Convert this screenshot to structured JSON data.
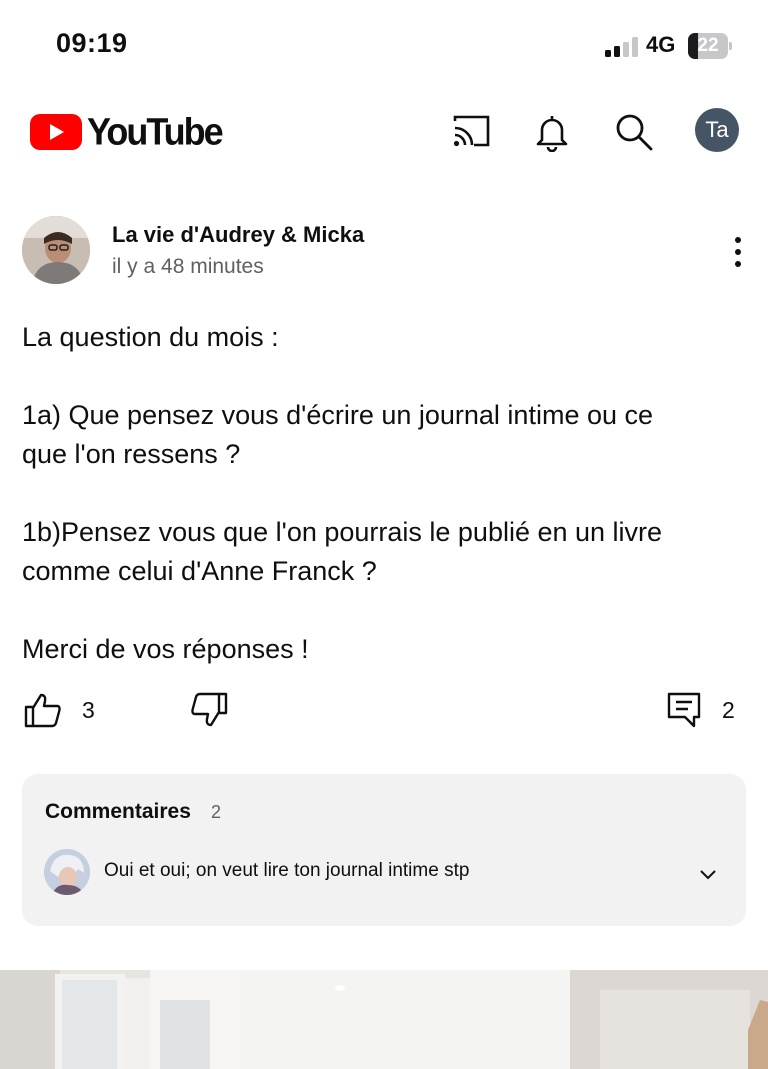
{
  "status_bar": {
    "time": "09:19",
    "network": "4G",
    "battery": "22"
  },
  "header": {
    "logo_text": "YouTube",
    "account_initials": "Ta",
    "icons": [
      "cast-icon",
      "bell-icon",
      "search-icon"
    ]
  },
  "post": {
    "channel_name": "La vie d'Audrey & Micka",
    "time_ago": "il y a 48 minutes",
    "lines": [
      "La question du mois :",
      "1a) Que pensez vous d'écrire un journal intime ou ce",
      "que l'on ressens ?",
      "1b)Pensez vous que l'on pourrais le publié en un livre",
      "comme celui d'Anne Franck ?",
      "Merci de vos réponses !"
    ],
    "likes": "3",
    "comment_count": "2"
  },
  "comments": {
    "title": "Commentaires",
    "count": "2",
    "top_comment": "Oui et oui; on veut lire ton journal intime stp"
  },
  "colors": {
    "brand_red": "#ff0000",
    "avatar_bg": "#465566",
    "card_bg": "#f2f2f2"
  }
}
